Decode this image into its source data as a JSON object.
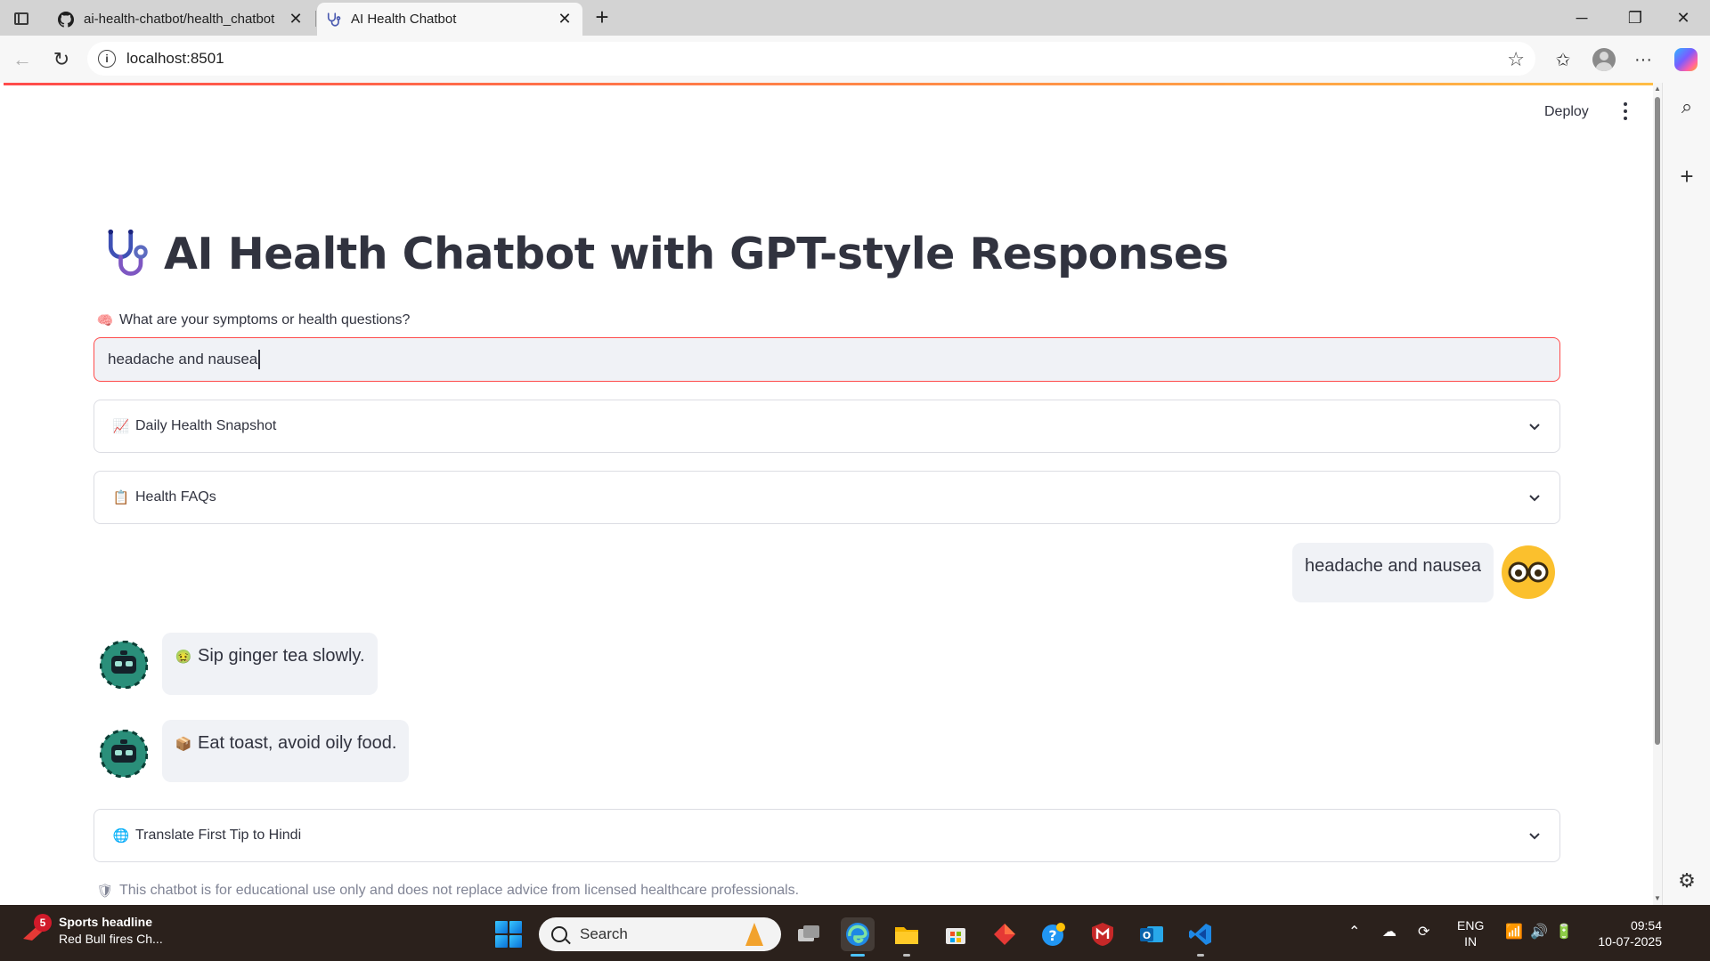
{
  "browser": {
    "tabs": [
      {
        "title": "ai-health-chatbot/health_chatbot",
        "active": false
      },
      {
        "title": "AI Health Chatbot",
        "active": true
      }
    ],
    "url": "localhost:8501"
  },
  "app": {
    "deploy_label": "Deploy",
    "title": "AI Health Chatbot with GPT-style Responses",
    "input_label": "What are your symptoms or health questions?",
    "input_value": "headache and nausea",
    "expanders": [
      {
        "label": "Daily Health Snapshot",
        "icon": "chart-increasing"
      },
      {
        "label": "Health FAQs",
        "icon": "clipboard"
      },
      {
        "label": "Translate First Tip to Hindi",
        "icon": "globe"
      }
    ],
    "messages": [
      {
        "role": "user",
        "text": "headache and nausea",
        "avatar": "nerd-face"
      },
      {
        "role": "assistant",
        "text": "Sip ginger tea slowly.",
        "icon": "nauseated-face"
      },
      {
        "role": "assistant",
        "text": "Eat toast, avoid oily food.",
        "icon": "package"
      }
    ],
    "disclaimer": "This chatbot is for educational use only and does not replace advice from licensed healthcare professionals."
  },
  "taskbar": {
    "news_badge": "5",
    "news_headline": "Sports headline",
    "news_sub": "Red Bull fires Ch...",
    "search_placeholder": "Search",
    "lang_1": "ENG",
    "lang_2": "IN",
    "time": "09:54",
    "date": "10-07-2025"
  },
  "colors": {
    "accent": "#ff4b4b",
    "secondary_bg": "#f0f2f6",
    "text": "#31333f",
    "taskbar_bg": "#2b211c"
  }
}
